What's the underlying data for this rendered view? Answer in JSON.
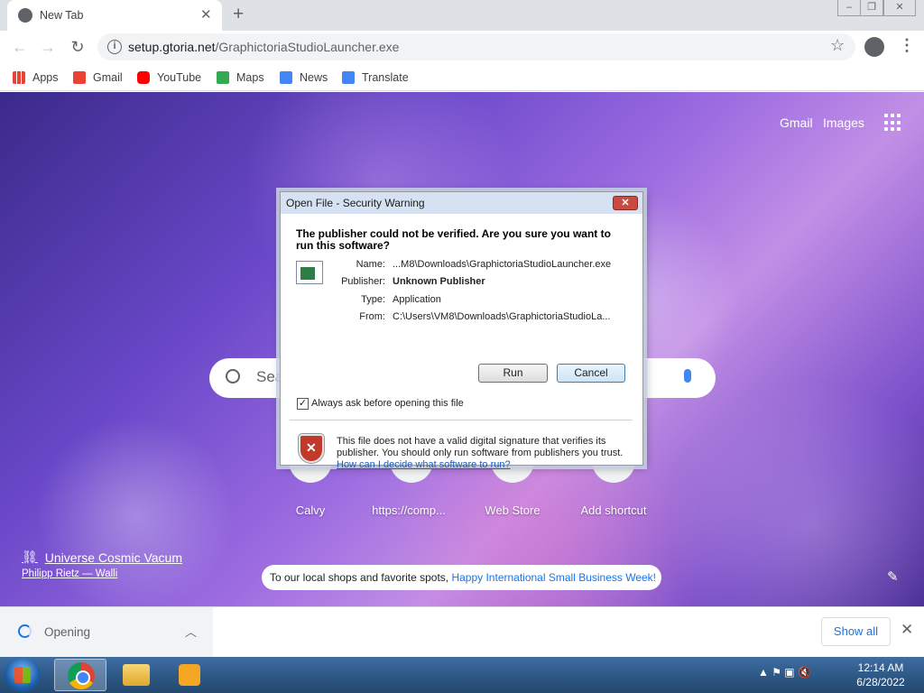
{
  "browser": {
    "tab_title": "New Tab",
    "url_host": "setup.gtoria.net",
    "url_path": "/GraphictoriaStudioLauncher.exe",
    "bookmarks": [
      "Apps",
      "Gmail",
      "YouTube",
      "Maps",
      "News",
      "Translate"
    ]
  },
  "ntp": {
    "gmail": "Gmail",
    "images": "Images",
    "search_placeholder": "Sea",
    "shortcuts": [
      "Calvy",
      "https://comp...",
      "Web Store",
      "Add shortcut"
    ],
    "attribution_title": "Universe Cosmic Vacum",
    "attribution_author": "Philipp Rietz — Walli",
    "promo_text": "To our local shops and favorite spots, ",
    "promo_link": "Happy International Small Business Week!"
  },
  "dialog": {
    "title": "Open File - Security Warning",
    "question": "The publisher could not be verified.  Are you sure you want to run this software?",
    "name_label": "Name:",
    "name_value": "...M8\\Downloads\\GraphictoriaStudioLauncher.exe",
    "publisher_label": "Publisher:",
    "publisher_value": "Unknown Publisher",
    "type_label": "Type:",
    "type_value": "Application",
    "from_label": "From:",
    "from_value": "C:\\Users\\VM8\\Downloads\\GraphictoriaStudioLa...",
    "run": "Run",
    "cancel": "Cancel",
    "checkbox_label": "Always ask before opening this file",
    "checkbox_checked": true,
    "warning": "This file does not have a valid digital signature that verifies its publisher.  You should only run software from publishers you trust.",
    "help_link": "How can I decide what software to run?"
  },
  "downloads": {
    "item_status": "Opening",
    "show_all": "Show all"
  },
  "taskbar": {
    "time": "12:14 AM",
    "date": "6/28/2022"
  }
}
